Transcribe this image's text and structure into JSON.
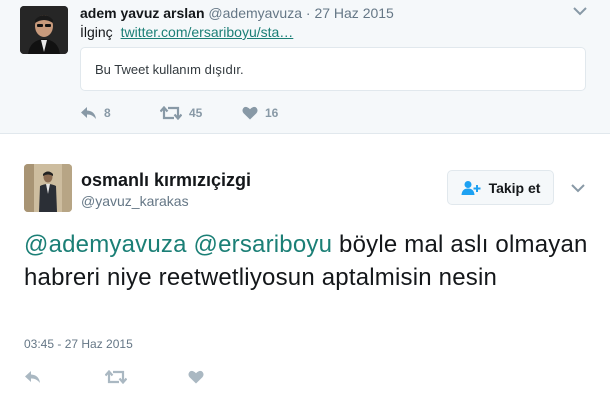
{
  "parent_tweet": {
    "display_name": "adem yavuz arslan",
    "handle": "@ademyavuza",
    "separator": "·",
    "date": "27 Haz 2015",
    "text_prefix": "İlginç",
    "link_text": "twitter.com/ersariboyu/sta…",
    "withheld_notice": "Bu Tweet kullanım dışıdır.",
    "actions": {
      "reply_icon": "reply-icon",
      "reply_count": "8",
      "retweet_icon": "retweet-icon",
      "retweet_count": "45",
      "like_icon": "heart-icon",
      "like_count": "16"
    }
  },
  "main_tweet": {
    "display_name": "osmanlı kırmızıçizgi",
    "handle": "@yavuz_karakas",
    "follow_label": "Takip et",
    "follow_icon": "follow-user-icon",
    "mention_1": "@ademyavuza",
    "mention_2": "@ersariboyu",
    "body": "böyle mal aslı olmayan habreri niye reetwetliyosun aptalmisin nesin",
    "timestamp": "03:45 - 27 Haz 2015",
    "actions": {
      "reply_icon": "reply-icon",
      "retweet_icon": "retweet-icon",
      "like_icon": "heart-icon"
    }
  },
  "colors": {
    "link": "#1b7f76",
    "muted": "#657786",
    "action_icon": "#8899a6",
    "context_background": "#f5f8fa",
    "border": "#e1e8ed"
  }
}
